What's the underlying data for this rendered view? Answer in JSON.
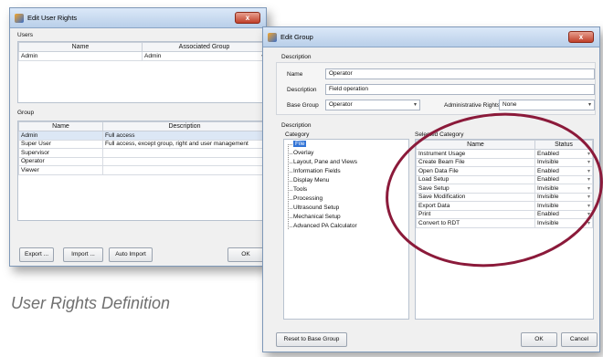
{
  "user_rights_window": {
    "title": "Edit User Rights",
    "close_label": "x",
    "users_section_label": "Users",
    "users_columns": [
      "Name",
      "Associated Group"
    ],
    "users_rows": [
      {
        "name": "Admin",
        "group": "Admin"
      }
    ],
    "group_section_label": "Group",
    "group_columns": [
      "Name",
      "Description"
    ],
    "group_rows": [
      {
        "name": "Admin",
        "description": "Full access"
      },
      {
        "name": "Super User",
        "description": "Full access, except group, right and user management"
      },
      {
        "name": "Supervisor",
        "description": ""
      },
      {
        "name": "Operator",
        "description": ""
      },
      {
        "name": "Viewer",
        "description": ""
      }
    ],
    "buttons": {
      "export": "Export ...",
      "import": "Import ...",
      "auto_import": "Auto Import",
      "ok": "OK"
    }
  },
  "caption": "User Rights Definition",
  "edit_group_window": {
    "title": "Edit Group",
    "close_label": "x",
    "description_section_label": "Description",
    "fields": {
      "name_label": "Name",
      "name_value": "Operator",
      "description_label": "Description",
      "description_value": "Field operation",
      "base_group_label": "Base Group",
      "base_group_value": "Operator",
      "admin_rights_label": "Administrative Rights",
      "admin_rights_value": "None"
    },
    "description2_label": "Description",
    "category_label": "Category",
    "categories": [
      "File",
      "Overlay",
      "Layout, Pane and Views",
      "Information Fields",
      "Display Menu",
      "Tools",
      "Processing",
      "Ultrasound Setup",
      "Mechanical Setup",
      "Advanced PA Calculator"
    ],
    "selected_category_label": "Selected Category",
    "rights_columns": [
      "Name",
      "Status"
    ],
    "rights_rows": [
      {
        "name": "Instrument Usage",
        "status": "Enabled"
      },
      {
        "name": "Create Beam File",
        "status": "Invisible"
      },
      {
        "name": "Open Data File",
        "status": "Enabled"
      },
      {
        "name": "Load Setup",
        "status": "Enabled"
      },
      {
        "name": "Save Setup",
        "status": "Invisible"
      },
      {
        "name": "Save Modification",
        "status": "Invisible"
      },
      {
        "name": "Export Data",
        "status": "Invisible"
      },
      {
        "name": "Print",
        "status": "Enabled"
      },
      {
        "name": "Convert to RDT",
        "status": "Invisible"
      }
    ],
    "buttons": {
      "reset": "Reset to Base Group",
      "ok": "OK",
      "cancel": "Cancel"
    }
  },
  "colors": {
    "highlight_ellipse": "#8b1a3a",
    "selection": "#3375d6"
  }
}
